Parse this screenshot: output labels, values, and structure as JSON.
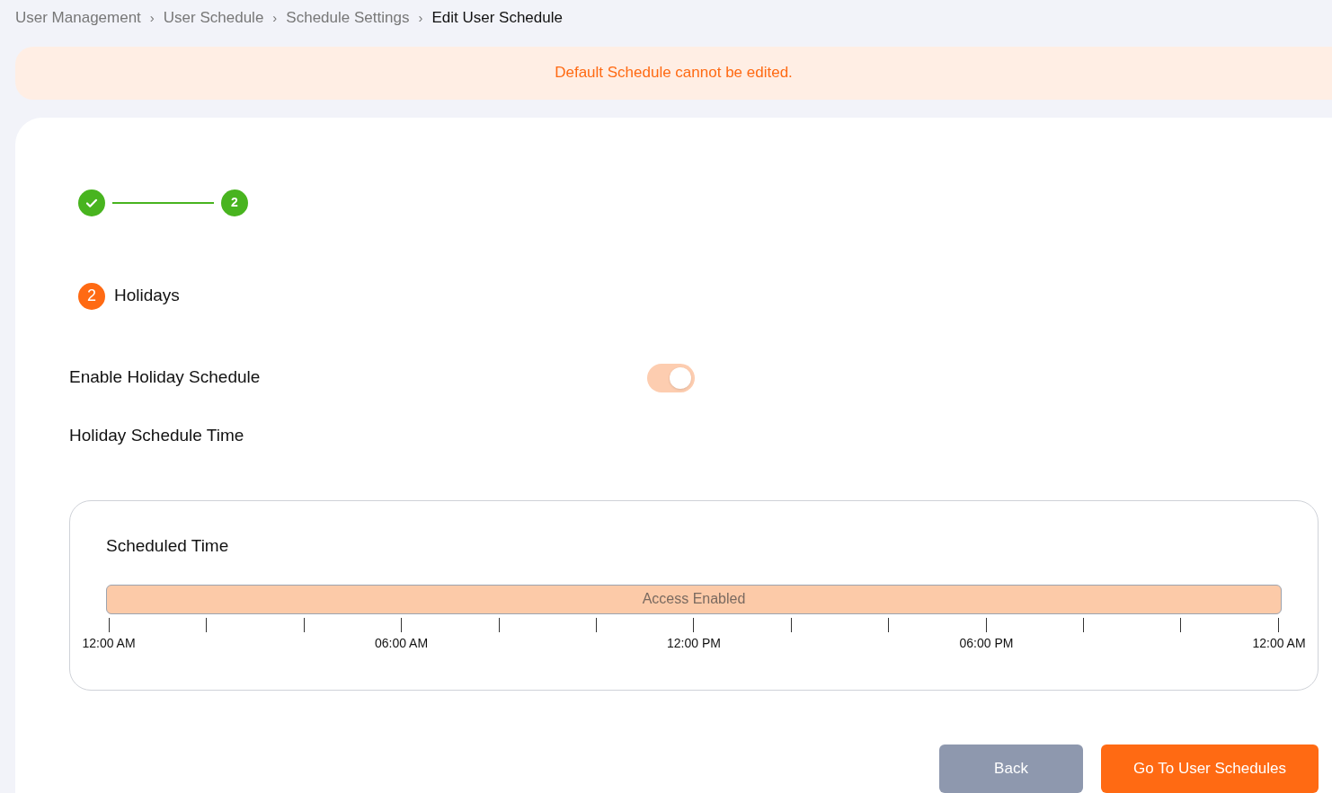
{
  "breadcrumb": [
    {
      "label": "User Management",
      "current": false
    },
    {
      "label": "User Schedule",
      "current": false
    },
    {
      "label": "Schedule Settings",
      "current": false
    },
    {
      "label": "Edit User Schedule",
      "current": true
    }
  ],
  "breadcrumb_separator": "›",
  "alert": {
    "message": "Default Schedule cannot be edited."
  },
  "stepper": [
    {
      "completed": true
    },
    {
      "label": "2",
      "completed": false
    }
  ],
  "section": {
    "number": "2",
    "title": "Holidays"
  },
  "enable_holiday_schedule": {
    "label": "Enable Holiday Schedule",
    "on": true,
    "disabled": true
  },
  "holiday_schedule_time_label": "Holiday Schedule Time",
  "scheduled_time": {
    "title": "Scheduled Time",
    "bar_label": "Access Enabled",
    "axis_labels": [
      "12:00 AM",
      "06:00 AM",
      "12:00 PM",
      "06:00 PM",
      "12:00 AM"
    ]
  },
  "buttons": [
    {
      "label": "Back",
      "kind": "secondary"
    },
    {
      "label": "Go To User Schedules",
      "kind": "primary"
    }
  ]
}
